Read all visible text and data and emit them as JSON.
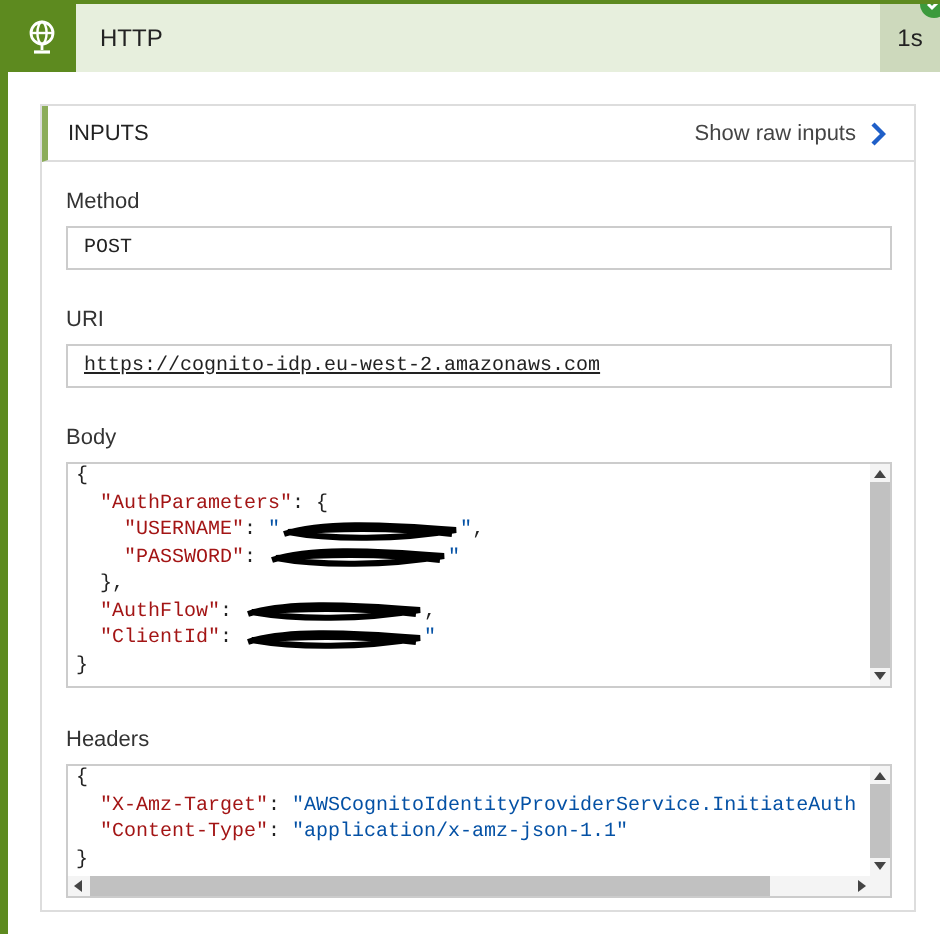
{
  "step": {
    "title": "HTTP",
    "duration": "1s",
    "succeeded": true
  },
  "inputs": {
    "title": "INPUTS",
    "link": "Show raw inputs",
    "fields": [
      {
        "label": "Method",
        "kind": "text",
        "value": "POST"
      },
      {
        "label": "URI",
        "kind": "link",
        "value": "https://cognito-idp.eu-west-2.amazonaws.com"
      },
      {
        "label": "Body",
        "kind": "code",
        "lines": [
          [
            {
              "kind": "punct",
              "text": "{"
            }
          ],
          [
            {
              "kind": "key",
              "text": "  \"AuthParameters\""
            },
            {
              "kind": "punct",
              "text": ": {"
            }
          ],
          [
            {
              "kind": "key",
              "text": "    \"USERNAME\""
            },
            {
              "kind": "punct",
              "text": ": "
            },
            {
              "kind": "string",
              "text": "\""
            },
            {
              "kind": "redacted"
            },
            {
              "kind": "string",
              "text": "\""
            },
            {
              "kind": "punct",
              "text": ","
            }
          ],
          [
            {
              "kind": "key",
              "text": "    \"PASSWORD\""
            },
            {
              "kind": "punct",
              "text": ": "
            },
            {
              "kind": "redacted"
            },
            {
              "kind": "string",
              "text": "\""
            }
          ],
          [
            {
              "kind": "punct",
              "text": "  },"
            }
          ],
          [
            {
              "kind": "key",
              "text": "  \"AuthFlow\""
            },
            {
              "kind": "punct",
              "text": ": "
            },
            {
              "kind": "redacted"
            },
            {
              "kind": "punct",
              "text": ","
            }
          ],
          [
            {
              "kind": "key",
              "text": "  \"ClientId\""
            },
            {
              "kind": "punct",
              "text": ": "
            },
            {
              "kind": "redacted"
            },
            {
              "kind": "string",
              "text": "\""
            }
          ],
          [
            {
              "kind": "punct",
              "text": "}"
            }
          ]
        ]
      },
      {
        "label": "Headers",
        "kind": "code",
        "hscroll": true,
        "lines": [
          [
            {
              "kind": "punct",
              "text": "{"
            }
          ],
          [
            {
              "kind": "key",
              "text": "  \"X-Amz-Target\""
            },
            {
              "kind": "punct",
              "text": ": "
            },
            {
              "kind": "string",
              "text": "\"AWSCognitoIdentityProviderService.InitiateAuth"
            }
          ],
          [
            {
              "kind": "key",
              "text": "  \"Content-Type\""
            },
            {
              "kind": "punct",
              "text": ": "
            },
            {
              "kind": "string",
              "text": "\"application/x-amz-json-1.1\""
            }
          ],
          [
            {
              "kind": "punct",
              "text": "}"
            }
          ]
        ]
      }
    ]
  }
}
